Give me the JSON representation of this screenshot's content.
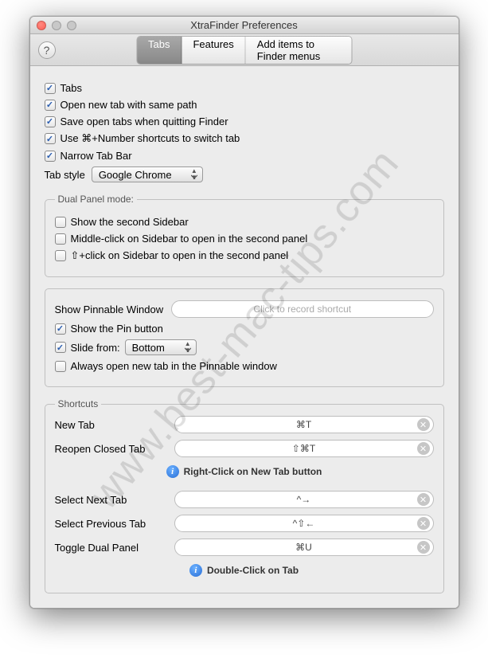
{
  "window": {
    "title": "XtraFinder Preferences"
  },
  "tabs": {
    "items": [
      "Tabs",
      "Features",
      "Add items to Finder menus"
    ],
    "active": 0
  },
  "options": {
    "tabs": "Tabs",
    "open_same_path": "Open new tab with same path",
    "save_on_quit": "Save open tabs when quitting Finder",
    "cmd_number": "Use ⌘+Number shortcuts to switch tab",
    "narrow": "Narrow Tab Bar"
  },
  "tabstyle": {
    "label": "Tab style",
    "value": "Google Chrome"
  },
  "dualpanel": {
    "legend": "Dual Panel mode:",
    "show_second_sidebar": "Show the second Sidebar",
    "middle_click": "Middle-click on Sidebar to open in the second panel",
    "shift_click": "⇧+click on Sidebar to open in the second panel"
  },
  "pinnable": {
    "show_label": "Show Pinnable Window",
    "record_placeholder": "Click to record shortcut",
    "show_pin": "Show the Pin button",
    "slide_label": "Slide from:",
    "slide_value": "Bottom",
    "always_open": "Always open new tab in the Pinnable window"
  },
  "shortcuts": {
    "legend": "Shortcuts",
    "new_tab": {
      "label": "New Tab",
      "value": "⌘T"
    },
    "reopen": {
      "label": "Reopen Closed Tab",
      "value": "⇧⌘T"
    },
    "hint1": "Right-Click on New Tab button",
    "next": {
      "label": "Select Next Tab",
      "value": "^→"
    },
    "prev": {
      "label": "Select Previous Tab",
      "value": "^⇧←"
    },
    "toggle": {
      "label": "Toggle Dual Panel",
      "value": "⌘U"
    },
    "hint2": "Double-Click on Tab"
  },
  "watermark": "www.best-mac-tips.com"
}
